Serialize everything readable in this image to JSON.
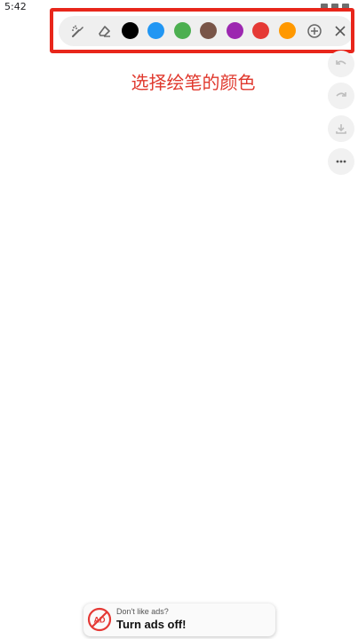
{
  "status_bar": {
    "time": "5:42"
  },
  "toolbar": {
    "tools": [
      {
        "icon": "brush-icon"
      },
      {
        "icon": "eraser-icon"
      }
    ],
    "swatches": [
      {
        "name": "black",
        "color": "#000000"
      },
      {
        "name": "blue",
        "color": "#2196f3"
      },
      {
        "name": "green",
        "color": "#4caf50"
      },
      {
        "name": "brown",
        "color": "#795548"
      },
      {
        "name": "purple",
        "color": "#9c27b0"
      },
      {
        "name": "red",
        "color": "#e53935"
      },
      {
        "name": "orange",
        "color": "#ff9800"
      }
    ],
    "add_icon": "add-circle-icon",
    "close_icon": "close-icon"
  },
  "caption": {
    "text": "选择绘笔的颜色"
  },
  "side_actions": [
    {
      "name": "undo",
      "icon": "undo-icon"
    },
    {
      "name": "redo",
      "icon": "redo-icon"
    },
    {
      "name": "download",
      "icon": "download-icon"
    },
    {
      "name": "more",
      "icon": "more-icon"
    }
  ],
  "ad": {
    "small_text": "Don't like ads?",
    "big_text": "Turn ads off!",
    "icon_label": "AD",
    "accent": "#e53935"
  },
  "colors": {
    "annotation": "#e8261b",
    "caption": "#e0382d",
    "toolbar_bg": "#efefef"
  }
}
